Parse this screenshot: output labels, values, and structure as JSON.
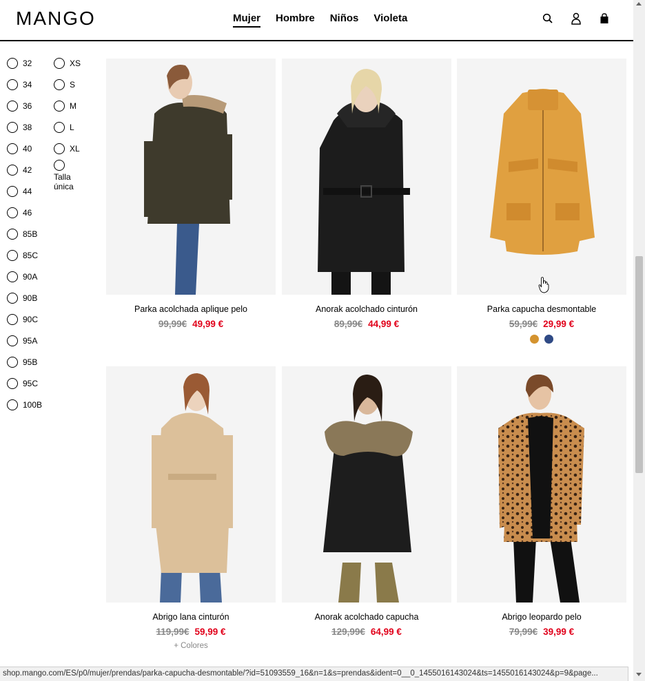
{
  "header": {
    "logo": "MANGO",
    "nav": [
      {
        "label": "Mujer",
        "active": true
      },
      {
        "label": "Hombre",
        "active": false
      },
      {
        "label": "Niños",
        "active": false
      },
      {
        "label": "Violeta",
        "active": false
      }
    ],
    "icons": [
      "search-icon",
      "user-icon",
      "shopping-bag-icon"
    ]
  },
  "filters": {
    "sizes_numeric": [
      "32",
      "34",
      "36",
      "38",
      "40",
      "42",
      "44",
      "46",
      "85B",
      "85C",
      "90A",
      "90B",
      "90C",
      "95A",
      "95B",
      "95C",
      "100B"
    ],
    "sizes_letter": [
      "XS",
      "S",
      "M",
      "L",
      "XL",
      "Talla única"
    ]
  },
  "products": [
    {
      "name": "Parka acolchada aplique pelo",
      "old_price": "99,99€",
      "price": "49,99 €",
      "colors": [],
      "more_colors": ""
    },
    {
      "name": "Anorak acolchado cinturón",
      "old_price": "89,99€",
      "price": "44,99 €",
      "colors": [],
      "more_colors": ""
    },
    {
      "name": "Parka capucha desmontable",
      "old_price": "59,99€",
      "price": "29,99 €",
      "colors": [
        "#d4932f",
        "#2f4a85"
      ],
      "more_colors": ""
    },
    {
      "name": "Abrigo lana cinturón",
      "old_price": "119,99€",
      "price": "59,99 €",
      "colors": [],
      "more_colors": "+ Colores"
    },
    {
      "name": "Anorak acolchado capucha",
      "old_price": "129,99€",
      "price": "64,99 €",
      "colors": [],
      "more_colors": ""
    },
    {
      "name": "Abrigo leopardo pelo",
      "old_price": "79,99€",
      "price": "39,99 €",
      "colors": [],
      "more_colors": ""
    }
  ],
  "statusbar": {
    "url": "shop.mango.com/ES/p0/mujer/prendas/parka-capucha-desmontable/?id=51093559_16&n=1&s=prendas&ident=0__0_1455016143024&ts=1455016143024&p=9&page..."
  },
  "colors": {
    "price_red": "#e1001a",
    "old_price_gray": "#888888"
  }
}
